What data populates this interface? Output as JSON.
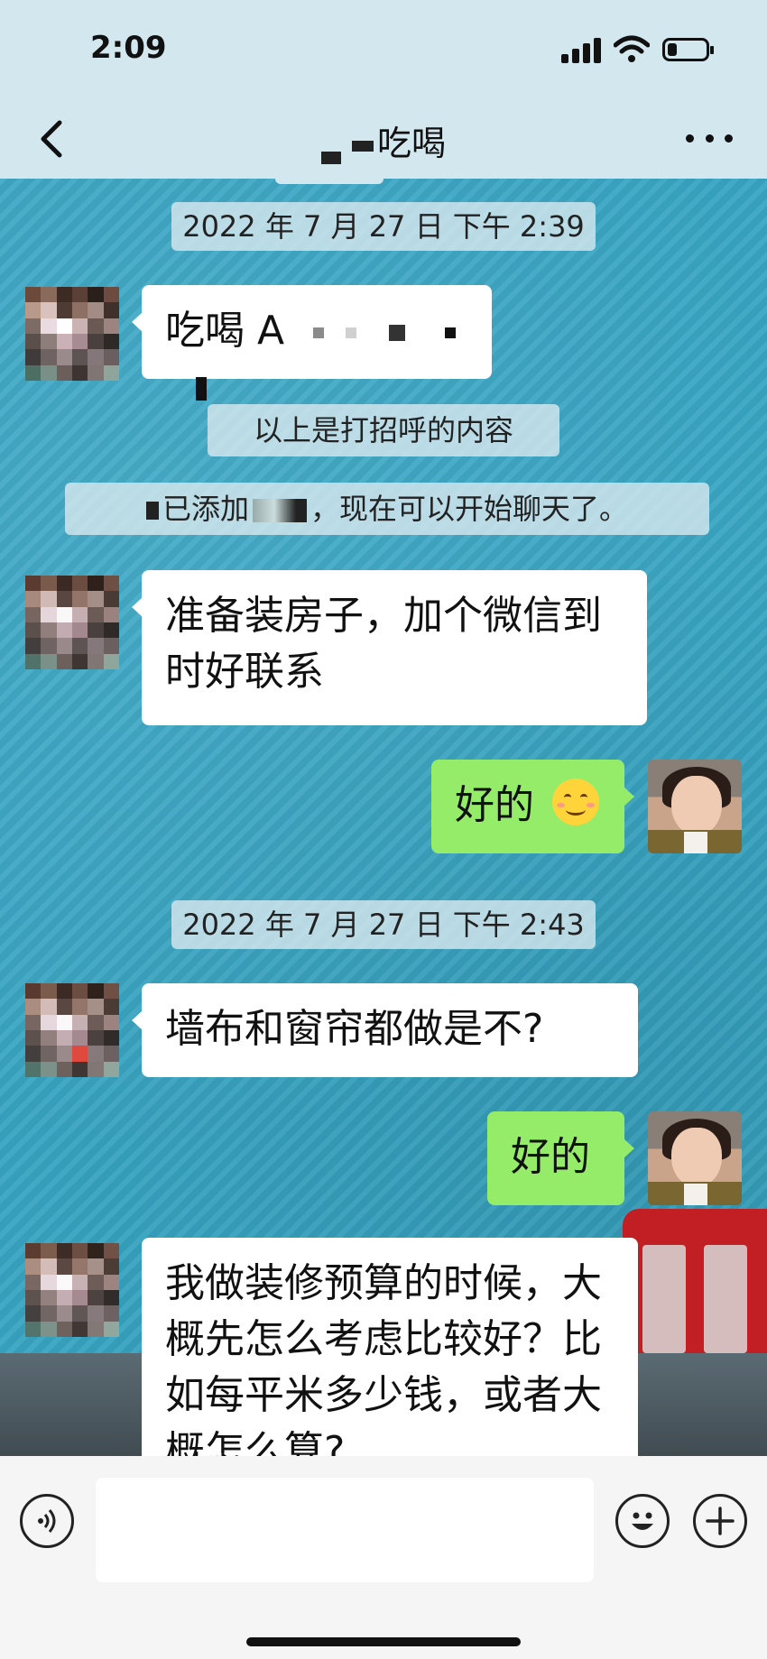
{
  "status_bar": {
    "time": "2:09",
    "battery_level": 0.25
  },
  "nav": {
    "title": "吃喝",
    "back_icon": "chevron-left-icon",
    "more_icon": "more-dots-icon"
  },
  "messages": {
    "ts1": "2022 年 7 月 27 日 下午 2:39",
    "greeting_text": "吃喝 A",
    "system_greeting": "以上是打招呼的内容",
    "system_added_prefix": "已添加",
    "system_added_suffix": "，现在可以开始聊天了。",
    "msg_prepare": "准备装房子，加个微信到时好联系",
    "reply1": "好的",
    "ts2": "2022 年 7 月 27 日 下午 2:43",
    "msg_wall": "墙布和窗帘都做是不?",
    "reply2": "好的",
    "msg_budget": "我做装修预算的时候，大概先怎么考虑比较好？比如每平米多少钱，或者大概怎么算?"
  },
  "input_bar": {
    "placeholder": "",
    "voice_icon": "voice-icon",
    "emoji_icon": "emoji-icon",
    "plus_icon": "plus-icon"
  },
  "colors": {
    "bubble_in": "#ffffff",
    "bubble_out": "#95ec69",
    "bar_bg": "#d3e7ef",
    "wallpaper": "#38a5c3"
  }
}
